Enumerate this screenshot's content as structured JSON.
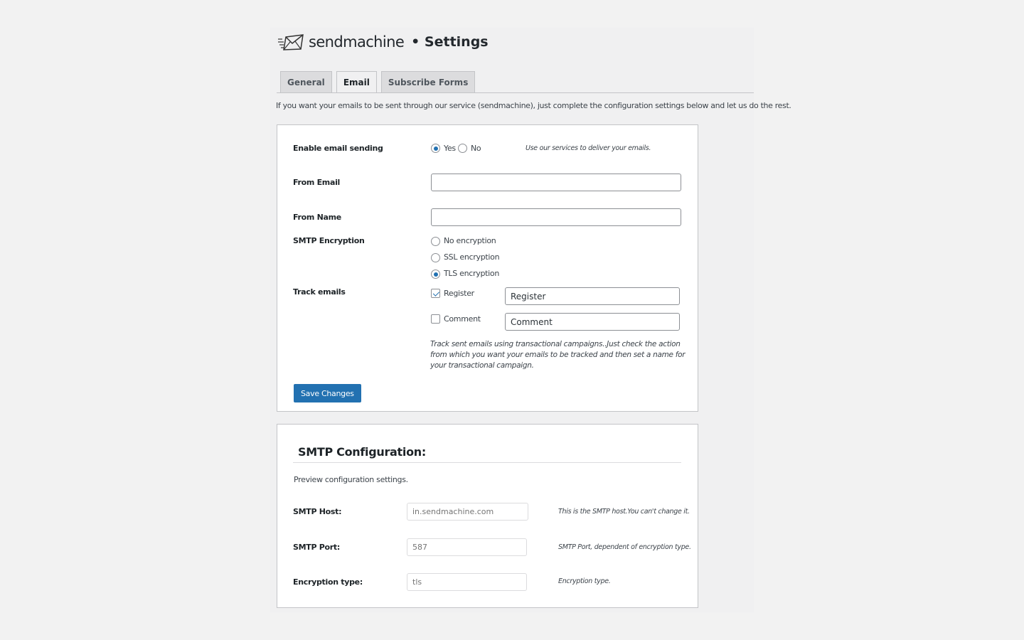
{
  "header": {
    "brand": "sendmachine",
    "page_title": "• Settings"
  },
  "tabs": [
    {
      "label": "General",
      "active": false
    },
    {
      "label": "Email",
      "active": true
    },
    {
      "label": "Subscribe Forms",
      "active": false
    }
  ],
  "intro": "If you want your emails to be sent through our service (sendmachine), just complete the configuration settings below and let us do the rest.",
  "email_settings": {
    "enable_label": "Enable email sending",
    "enable_yes": "Yes",
    "enable_no": "No",
    "enable_value": "Yes",
    "enable_hint": "Use our services to deliver your emails.",
    "from_email_label": "From Email",
    "from_email_value": "",
    "from_name_label": "From Name",
    "from_name_value": "",
    "encryption_label": "SMTP Encryption",
    "encryption_options": [
      "No encryption",
      "SSL encryption",
      "TLS encryption"
    ],
    "encryption_value": "TLS encryption",
    "track_label": "Track emails",
    "track_register_label": "Register",
    "track_register_checked": true,
    "track_register_value": "Register",
    "track_comment_label": "Comment",
    "track_comment_checked": false,
    "track_comment_value": "Comment",
    "track_hint_line1": "Track sent emails using transactional campaigns..Just check the action",
    "track_hint_line2": "from which you want your emails to be tracked and then set a name for",
    "track_hint_line3": "your transactional campaign.",
    "save_label": "Save Changes"
  },
  "smtp": {
    "title": "SMTP Configuration:",
    "subtitle": "Preview configuration settings.",
    "host_label": "SMTP Host:",
    "host_value": "in.sendmachine.com",
    "host_hint": "This is the SMTP host.You can't change it.",
    "port_label": "SMTP Port:",
    "port_value": "587",
    "port_hint": "SMTP Port, dependent of encryption type.",
    "enc_label": "Encryption type:",
    "enc_value": "tls",
    "enc_hint": "Encryption type."
  },
  "colors": {
    "primary": "#2271b1",
    "tab_bg": "#dcdcde",
    "page_bg": "#f0f0f1"
  }
}
